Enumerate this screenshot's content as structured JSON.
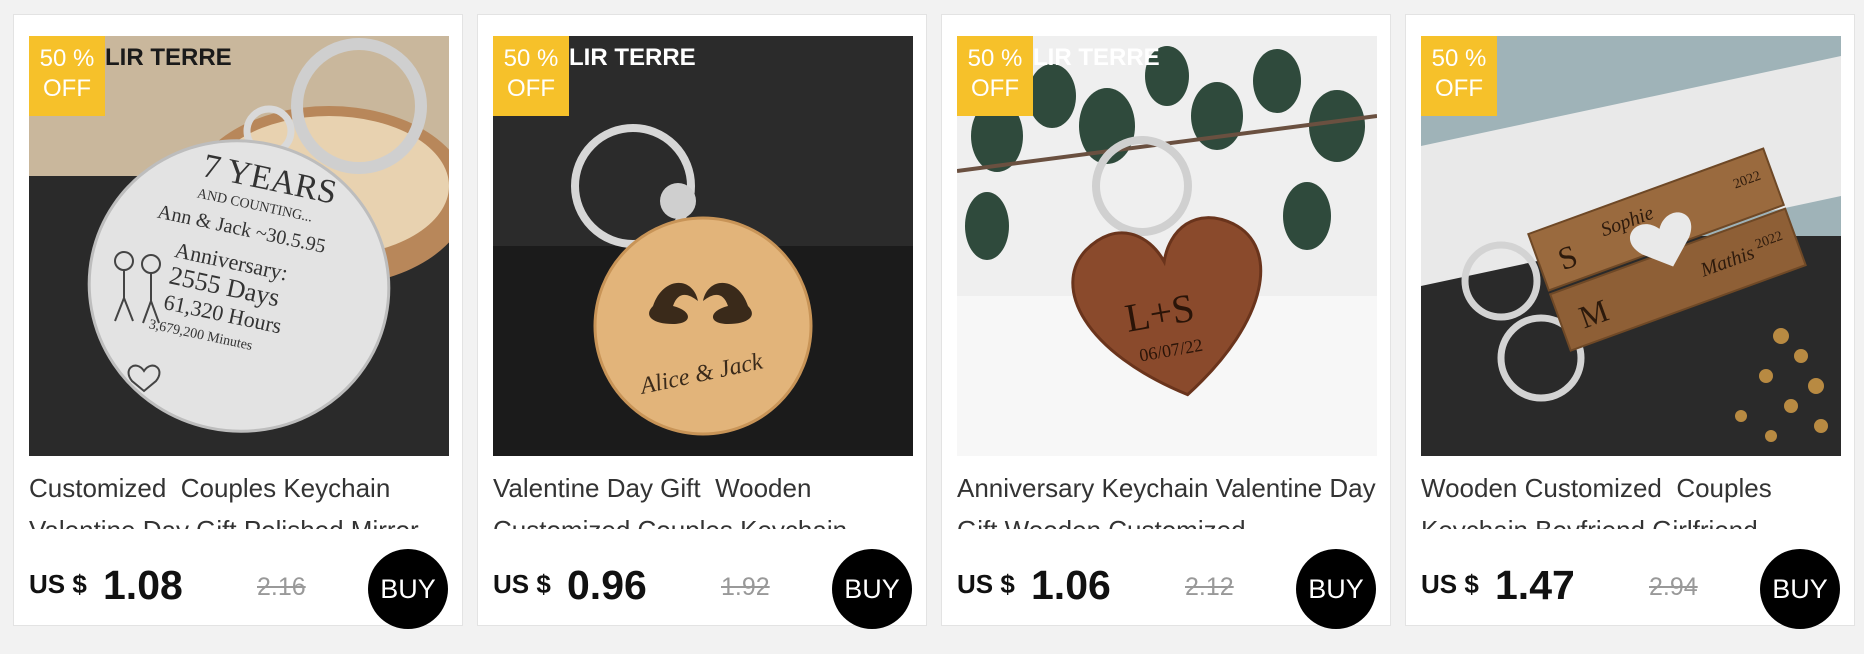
{
  "products": [
    {
      "badge": {
        "line1": "50 %",
        "line2": "OFF"
      },
      "brand": "LIR TERRE",
      "image_text": {
        "line1": "7 YEARS",
        "line2": "AND COUNTING...",
        "line3": "Ann & Jack ~30.5.95",
        "line4": "Anniversary:",
        "line5": "2555 Days",
        "line6": "61,320 Hours",
        "line7": "3,679,200 Minutes"
      },
      "title": "Customized  Couples Keychain Valentine Day Gift Polished Mirror",
      "currency": "US $",
      "price": "1.08",
      "original_price": "2.16",
      "buy_label": "BUY"
    },
    {
      "badge": {
        "line1": "50 %",
        "line2": "OFF"
      },
      "brand": "LIR TERRE",
      "image_text": {
        "line1": "Alice & Jack"
      },
      "title": "Valentine Day Gift  Wooden Customized Couples Keychain",
      "currency": "US $",
      "price": "0.96",
      "original_price": "1.92",
      "buy_label": "BUY"
    },
    {
      "badge": {
        "line1": "50 %",
        "line2": "OFF"
      },
      "brand": "LIR TERRE",
      "image_text": {
        "line1": "L+S",
        "line2": "06/07/22"
      },
      "title": "Anniversary Keychain Valentine Day Gift Wooden Customized",
      "currency": "US $",
      "price": "1.06",
      "original_price": "2.12",
      "buy_label": "BUY"
    },
    {
      "badge": {
        "line1": "50 %",
        "line2": "OFF"
      },
      "brand": "",
      "image_text": {
        "line1": "Sophie",
        "line2": "Mathis",
        "line3": "M",
        "line4": "S",
        "line5": "2022",
        "line6": "2022"
      },
      "title": "Wooden Customized  Couples Keychain Boyfriend Girlfriend",
      "currency": "US $",
      "price": "1.47",
      "original_price": "2.94",
      "buy_label": "BUY"
    }
  ],
  "colors": {
    "badge": "#f6c12a",
    "buy_button": "#000000",
    "page_bg": "#f2f2f2"
  }
}
